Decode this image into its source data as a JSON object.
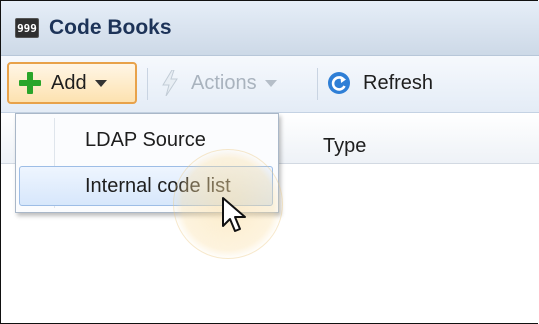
{
  "window": {
    "title": "Code Books",
    "title_icon": "999"
  },
  "toolbar": {
    "add_label": "Add",
    "actions_label": "Actions",
    "refresh_label": "Refresh"
  },
  "grid": {
    "columns": [
      "",
      "Type"
    ]
  },
  "add_menu": {
    "items": [
      {
        "label": "LDAP Source",
        "highlighted": false
      },
      {
        "label": "Internal code list",
        "highlighted": true
      }
    ]
  },
  "colors": {
    "title_text": "#1d3358",
    "add_border": "#e8a24a",
    "plus_green": "#2aa52a",
    "menu_highlight": "#d7e7fb",
    "click_halo": "#fadda0"
  }
}
